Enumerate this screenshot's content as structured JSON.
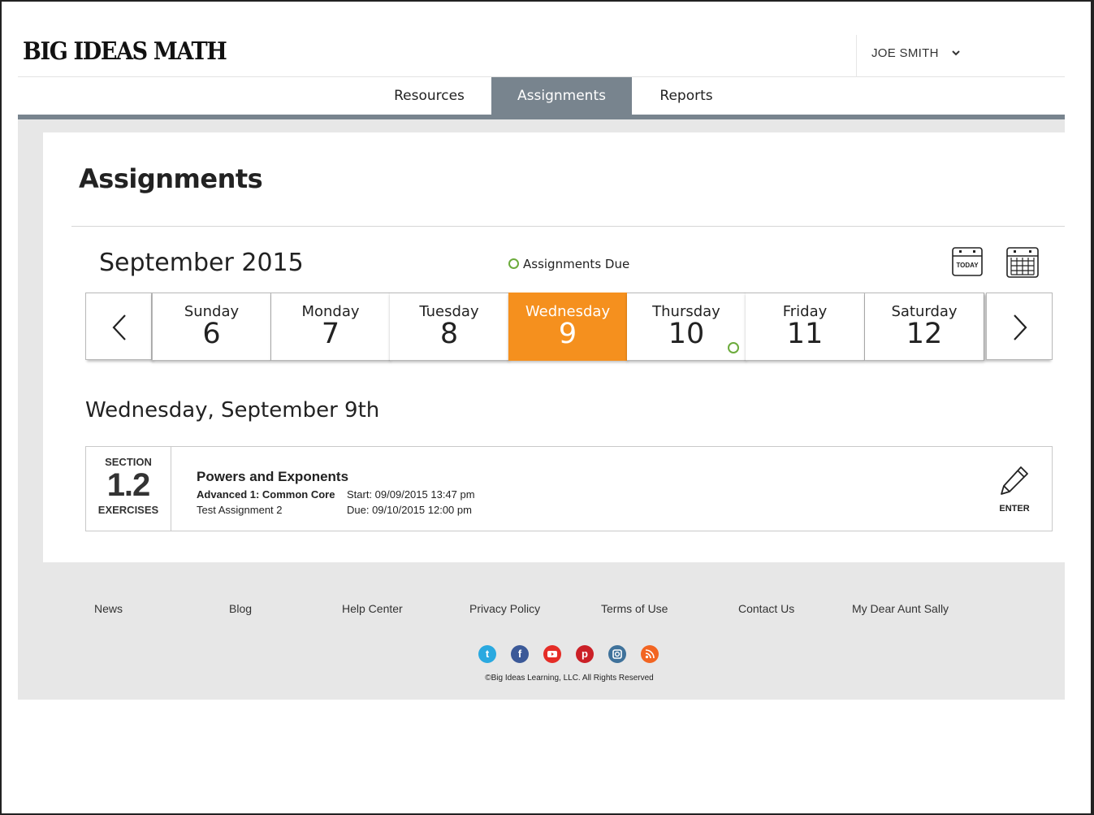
{
  "brand": {
    "logo_text": "BIG IDEAS MATH"
  },
  "user": {
    "name": "JOE SMITH"
  },
  "nav": {
    "tabs": [
      {
        "label": "Resources",
        "active": false
      },
      {
        "label": "Assignments",
        "active": true
      },
      {
        "label": "Reports",
        "active": false
      }
    ]
  },
  "page": {
    "title": "Assignments"
  },
  "calendar": {
    "month_label": "September 2015",
    "legend_label": "Assignments Due",
    "today_icon_label": "TODAY",
    "days": [
      {
        "name": "Sunday",
        "number": "6",
        "selected": false,
        "has_due": false
      },
      {
        "name": "Monday",
        "number": "7",
        "selected": false,
        "has_due": false
      },
      {
        "name": "Tuesday",
        "number": "8",
        "selected": false,
        "has_due": false
      },
      {
        "name": "Wednesday",
        "number": "9",
        "selected": true,
        "has_due": false
      },
      {
        "name": "Thursday",
        "number": "10",
        "selected": false,
        "has_due": true
      },
      {
        "name": "Friday",
        "number": "11",
        "selected": false,
        "has_due": false
      },
      {
        "name": "Saturday",
        "number": "12",
        "selected": false,
        "has_due": false
      }
    ]
  },
  "selected_date": {
    "heading": "Wednesday, September 9th"
  },
  "assignment": {
    "section_label": "SECTION",
    "section_number": "1.2",
    "section_type": "EXERCISES",
    "title": "Powers and Exponents",
    "course": "Advanced 1: Common Core",
    "name": "Test Assignment 2",
    "start": "Start: 09/09/2015 13:47 pm",
    "due": "Due: 09/10/2015 12:00 pm",
    "enter_label": "ENTER"
  },
  "footer": {
    "links": [
      "News",
      "Blog",
      "Help Center",
      "Privacy Policy",
      "Terms of Use",
      "Contact Us",
      "My Dear Aunt Sally"
    ],
    "social": [
      {
        "icon": "twitter-icon",
        "color": "#2aa9e0"
      },
      {
        "icon": "facebook-icon",
        "color": "#3b5998"
      },
      {
        "icon": "youtube-icon",
        "color": "#e52d27"
      },
      {
        "icon": "pinterest-icon",
        "color": "#cb2027"
      },
      {
        "icon": "instagram-icon",
        "color": "#3f729b"
      },
      {
        "icon": "rss-icon",
        "color": "#f26522"
      }
    ],
    "copyright": "©Big Ideas Learning, LLC. All Rights Reserved"
  },
  "colors": {
    "accent": "#f5901e",
    "nav_active": "#78848e",
    "due_indicator": "#6cab3c",
    "footer_bg": "#e7e7e7"
  }
}
